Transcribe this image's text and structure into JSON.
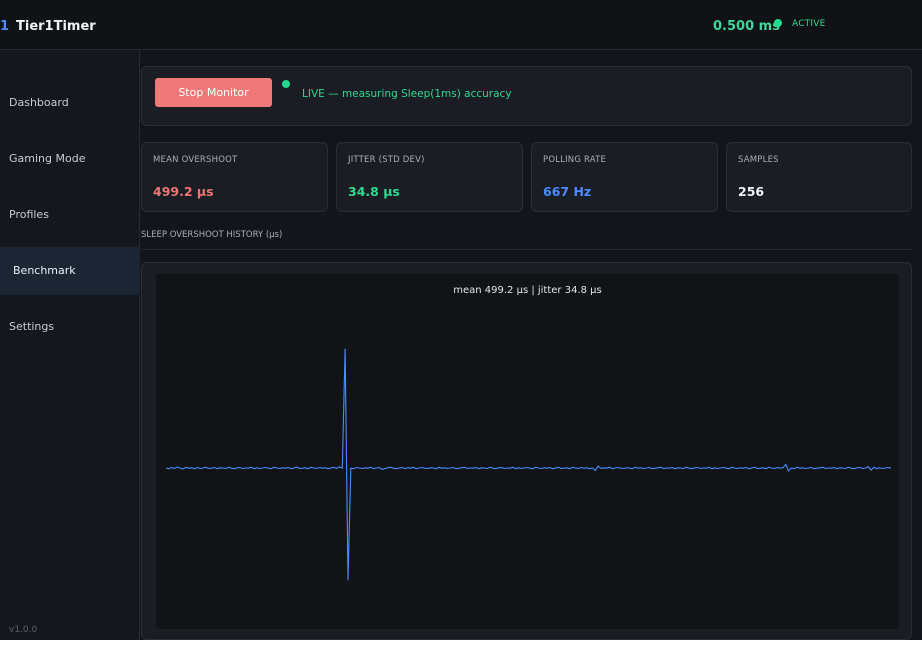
{
  "header": {
    "logo": "1",
    "title": "Tier1Timer",
    "timer_value": "0.500 ms",
    "status": "ACTIVE"
  },
  "sidebar": {
    "items": [
      {
        "label": "Dashboard"
      },
      {
        "label": "Gaming Mode"
      },
      {
        "label": "Profiles"
      },
      {
        "label": "Benchmark"
      },
      {
        "label": "Settings"
      }
    ],
    "active": "Benchmark",
    "version": "v1.0.0"
  },
  "control": {
    "stop_label": "Stop Monitor",
    "live_text": "LIVE — measuring Sleep(1ms) accuracy"
  },
  "stats": [
    {
      "label": "MEAN OVERSHOOT",
      "value": "499.2 μs",
      "color": "#f07575"
    },
    {
      "label": "JITTER (STD DEV)",
      "value": "34.8 μs",
      "color": "#2fd98f"
    },
    {
      "label": "POLLING RATE",
      "value": "667 Hz",
      "color": "#4a8cff"
    },
    {
      "label": "SAMPLES",
      "value": "256",
      "color": "#f2f4f7"
    }
  ],
  "history": {
    "section_label": "SLEEP OVERSHOOT HISTORY (μs)",
    "caption": "mean 499.2 μs  |  jitter 34.8 μs"
  },
  "chart_data": {
    "type": "line",
    "title": "mean 499.2 μs  |  jitter 34.8 μs",
    "series_color": "#4a8cff",
    "sample_count": 256,
    "ylim": [
      0,
      1000
    ],
    "baseline_level": 499.2,
    "samples": [
      500,
      497,
      502,
      498,
      504,
      499,
      496,
      503,
      499,
      501,
      497,
      502,
      498,
      500,
      503,
      498,
      499,
      502,
      497,
      501,
      500,
      498,
      503,
      499,
      497,
      501,
      502,
      498,
      500,
      499,
      503,
      497,
      501,
      498,
      500,
      502,
      499,
      497,
      503,
      500,
      498,
      501,
      499,
      502,
      497,
      500,
      504,
      498,
      499,
      501,
      497,
      503,
      500,
      498,
      502,
      499,
      501,
      497,
      500,
      503,
      498,
      505,
      499,
      1000,
      30,
      499,
      497,
      502,
      500,
      498,
      501,
      499,
      503,
      497,
      500,
      502,
      494,
      498,
      501,
      503,
      499,
      497,
      500,
      502,
      498,
      501,
      499,
      503,
      497,
      500,
      502,
      499,
      498,
      501,
      500,
      497,
      503,
      499,
      501,
      498,
      500,
      502,
      497,
      499,
      501,
      503,
      498,
      500,
      499,
      502,
      497,
      501,
      500,
      498,
      503,
      499,
      497,
      501,
      502,
      498,
      500,
      499,
      503,
      497,
      501,
      498,
      500,
      502,
      499,
      497,
      503,
      500,
      498,
      501,
      499,
      502,
      497,
      500,
      503,
      498,
      499,
      501,
      497,
      503,
      500,
      498,
      502,
      499,
      501,
      497,
      500,
      490,
      508,
      498,
      501,
      499,
      503,
      497,
      500,
      502,
      499,
      498,
      501,
      500,
      497,
      503,
      499,
      501,
      498,
      500,
      502,
      497,
      499,
      501,
      503,
      498,
      500,
      499,
      502,
      497,
      501,
      500,
      498,
      503,
      499,
      497,
      501,
      502,
      498,
      500,
      499,
      503,
      497,
      501,
      498,
      500,
      502,
      499,
      497,
      503,
      500,
      498,
      501,
      499,
      502,
      497,
      500,
      503,
      498,
      499,
      501,
      497,
      503,
      500,
      498,
      502,
      499,
      501,
      515,
      488,
      500,
      497,
      503,
      499,
      501,
      498,
      500,
      502,
      497,
      499,
      501,
      503,
      498,
      500,
      499,
      502,
      497,
      501,
      500,
      498,
      503,
      499,
      497,
      501,
      502,
      498,
      500,
      506,
      491,
      503,
      497,
      501,
      498,
      500,
      502,
      499
    ]
  }
}
